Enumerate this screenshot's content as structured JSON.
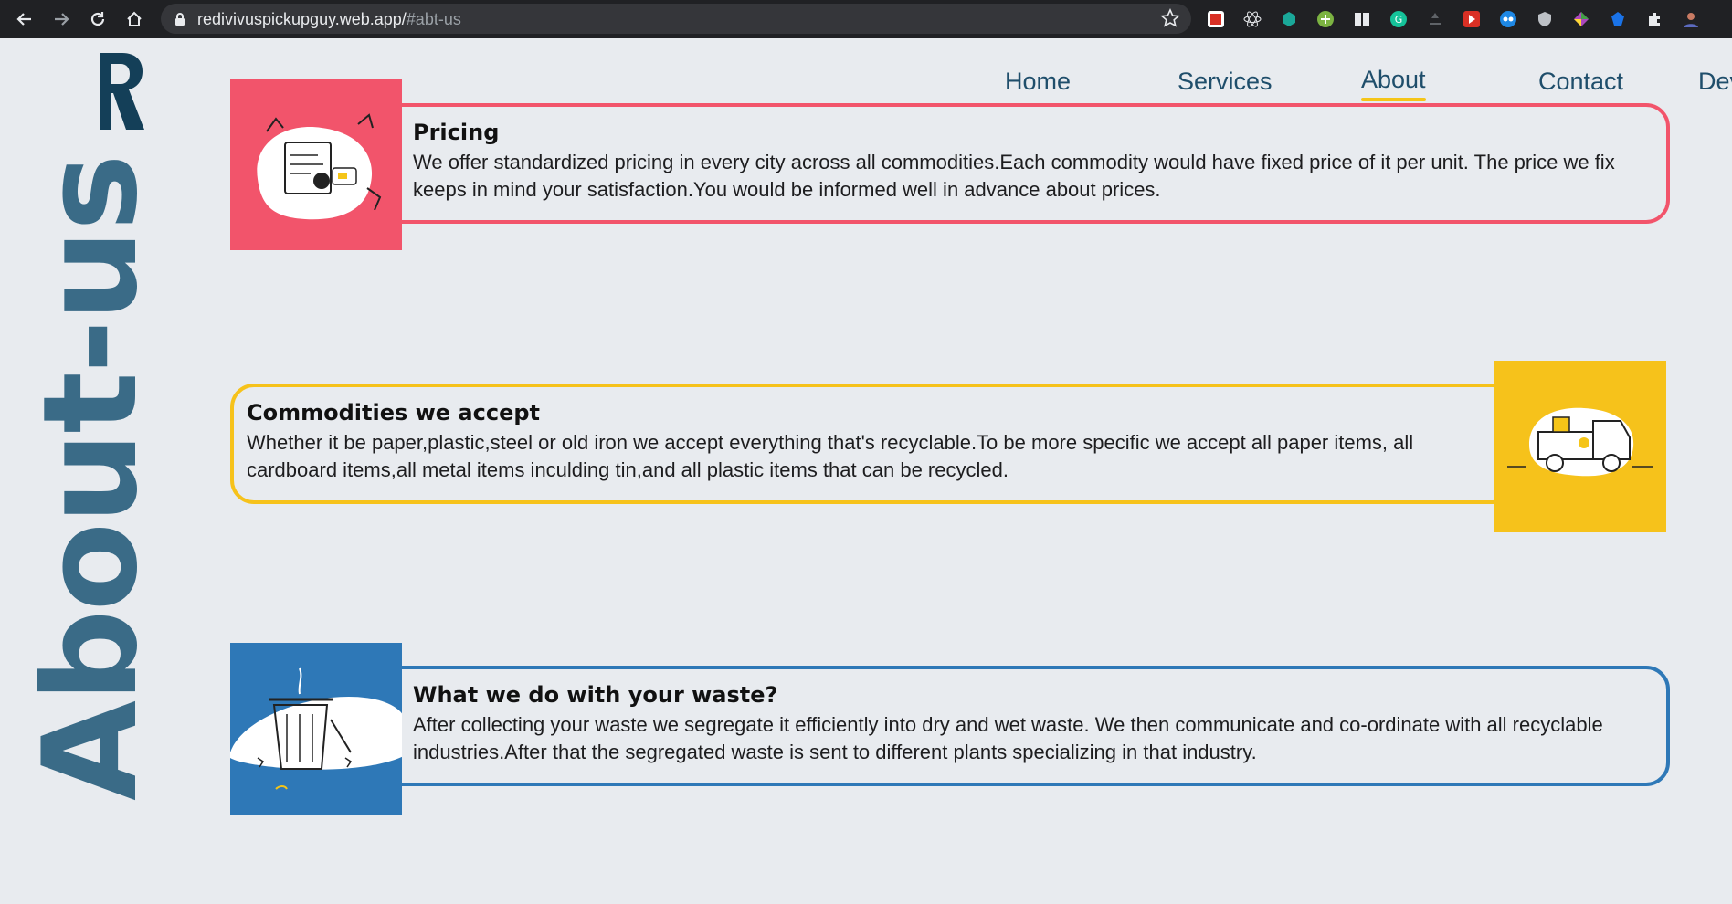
{
  "browser": {
    "url_host": "redivivuspickupguy.web.app/",
    "url_hash": "#abt-us"
  },
  "page": {
    "side_title": "About-us",
    "nav": [
      {
        "label": "Home"
      },
      {
        "label": "Services"
      },
      {
        "label": "About",
        "active": true
      },
      {
        "label": "Contact"
      },
      {
        "label": "Dev"
      }
    ],
    "sections": [
      {
        "title": "Pricing",
        "text": "We offer standardized pricing in every city across all commodities.Each commodity would have fixed price of it per unit. The price we fix keeps in mind your satisfaction.You would be informed well in advance about prices.",
        "color": "#f2546b",
        "illustration": "pricing-illustration"
      },
      {
        "title": "Commodities we accept",
        "text": "Whether it be paper,plastic,steel or old iron we accept everything that's recyclable.To be more specific we accept all paper items, all cardboard items,all metal items inculding tin,and all plastic items that can be recycled.",
        "color": "#f6c21b",
        "illustration": "truck-illustration"
      },
      {
        "title": "What we do with your waste?",
        "text": "After collecting your waste we segregate it efficiently into dry and wet waste. We then communicate and co-ordinate with all recyclable industries.After that the segregated waste is sent to different plants specializing in that industry.",
        "color": "#2e78b7",
        "illustration": "trash-bin-illustration"
      }
    ]
  },
  "colors": {
    "background": "#e8ebef",
    "nav_text": "#1f4e6b",
    "nav_active_underline": "#f5c518",
    "side_title": "#3a6b87"
  }
}
